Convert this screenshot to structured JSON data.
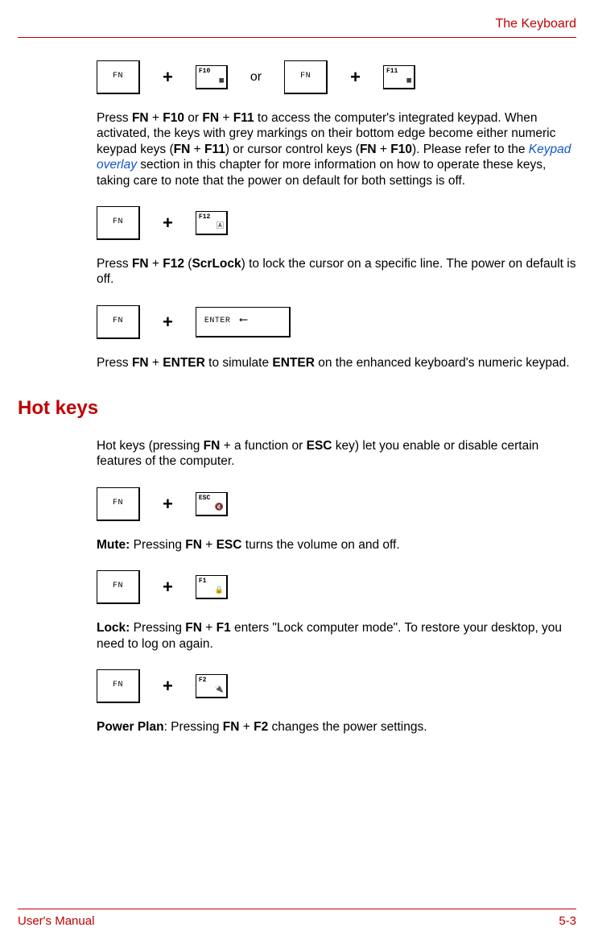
{
  "header": {
    "title": "The Keyboard"
  },
  "row1": {
    "fn1": "FN",
    "key1": "F10",
    "or": "or",
    "fn2": "FN",
    "key2": "F11"
  },
  "para1": {
    "t1": "Press ",
    "b1": "FN",
    "t2": " + ",
    "b2": "F10",
    "t3": " or ",
    "b3": "FN",
    "t4": " + ",
    "b4": "F11",
    "t5": " to access the computer's integrated keypad. When activated, the keys with grey markings on their bottom edge become either numeric keypad keys (",
    "b5": "FN",
    "t6": " + ",
    "b6": "F11",
    "t7": ") or cursor control keys (",
    "b7": "FN",
    "t8": " + ",
    "b8": "F10",
    "t9": "). Please refer to the ",
    "link": "Keypad overlay",
    "t10": " section in this chapter for more information on how to operate these keys, taking care to note that the power on default for both settings is off."
  },
  "row2": {
    "fn": "FN",
    "key": "F12"
  },
  "para2": {
    "t1": "Press ",
    "b1": "FN",
    "t2": " + ",
    "b2": "F12",
    "t3": " (",
    "b3": "ScrLock",
    "t4": ") to lock the cursor on a specific line. The power on default is off."
  },
  "row3": {
    "fn": "FN",
    "key": "ENTER"
  },
  "para3": {
    "t1": "Press ",
    "b1": "FN",
    "t2": " + ",
    "b2": "ENTER",
    "t3": " to simulate ",
    "b3": "ENTER",
    "t4": " on the enhanced keyboard's numeric keypad."
  },
  "section": {
    "heading": "Hot keys"
  },
  "para4": {
    "t1": "Hot keys (pressing ",
    "b1": "FN",
    "t2": " + a function or ",
    "b2": "ESC",
    "t3": " key) let you enable or disable certain features of the computer."
  },
  "row4": {
    "fn": "FN",
    "key": "ESC"
  },
  "para5": {
    "b1": "Mute:",
    "t1": " Pressing ",
    "b2": "FN",
    "t2": " + ",
    "b3": "ESC",
    "t3": " turns the volume on and off."
  },
  "row5": {
    "fn": "FN",
    "key": "F1"
  },
  "para6": {
    "b1": "Lock:",
    "t1": " Pressing ",
    "b2": "FN",
    "t2": " + ",
    "b3": "F1",
    "t3": " enters \"Lock computer mode\". To restore your desktop, you need to log on again."
  },
  "row6": {
    "fn": "FN",
    "key": "F2"
  },
  "para7": {
    "b1": "Power Plan",
    "t1": ": Pressing ",
    "b2": "FN",
    "t2": " + ",
    "b3": "F2",
    "t3": " changes the power settings."
  },
  "footer": {
    "left": "User's Manual",
    "right": "5-3"
  }
}
